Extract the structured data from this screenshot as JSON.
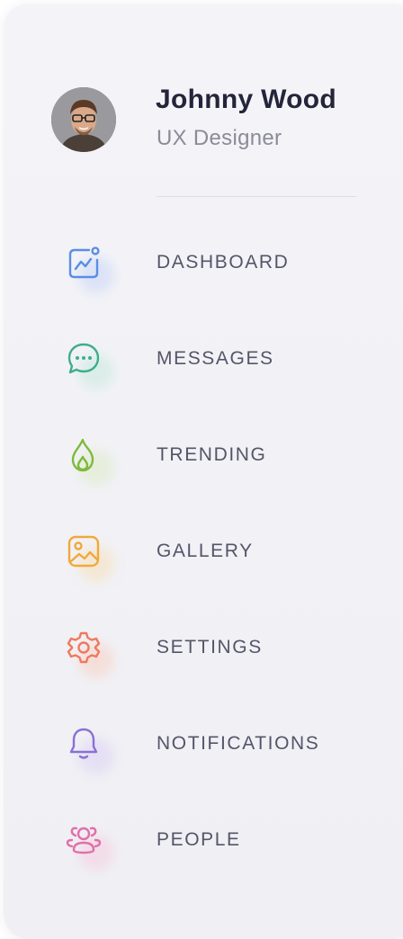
{
  "profile": {
    "name": "Johnny Wood",
    "role": "UX Designer"
  },
  "nav": {
    "items": [
      {
        "label": "DASHBOARD",
        "icon": "dashboard-icon",
        "color": "#5a8ee6"
      },
      {
        "label": "MESSAGES",
        "icon": "chat-bubble-icon",
        "color": "#3fae8a"
      },
      {
        "label": "TRENDING",
        "icon": "flame-icon",
        "color": "#7fba3c"
      },
      {
        "label": "GALLERY",
        "icon": "image-icon",
        "color": "#f0a93a"
      },
      {
        "label": "SETTINGS",
        "icon": "gear-icon",
        "color": "#ee7a5e"
      },
      {
        "label": "NOTIFICATIONS",
        "icon": "bell-icon",
        "color": "#8a6fd6"
      },
      {
        "label": "PEOPLE",
        "icon": "people-icon",
        "color": "#e070a8"
      }
    ]
  }
}
